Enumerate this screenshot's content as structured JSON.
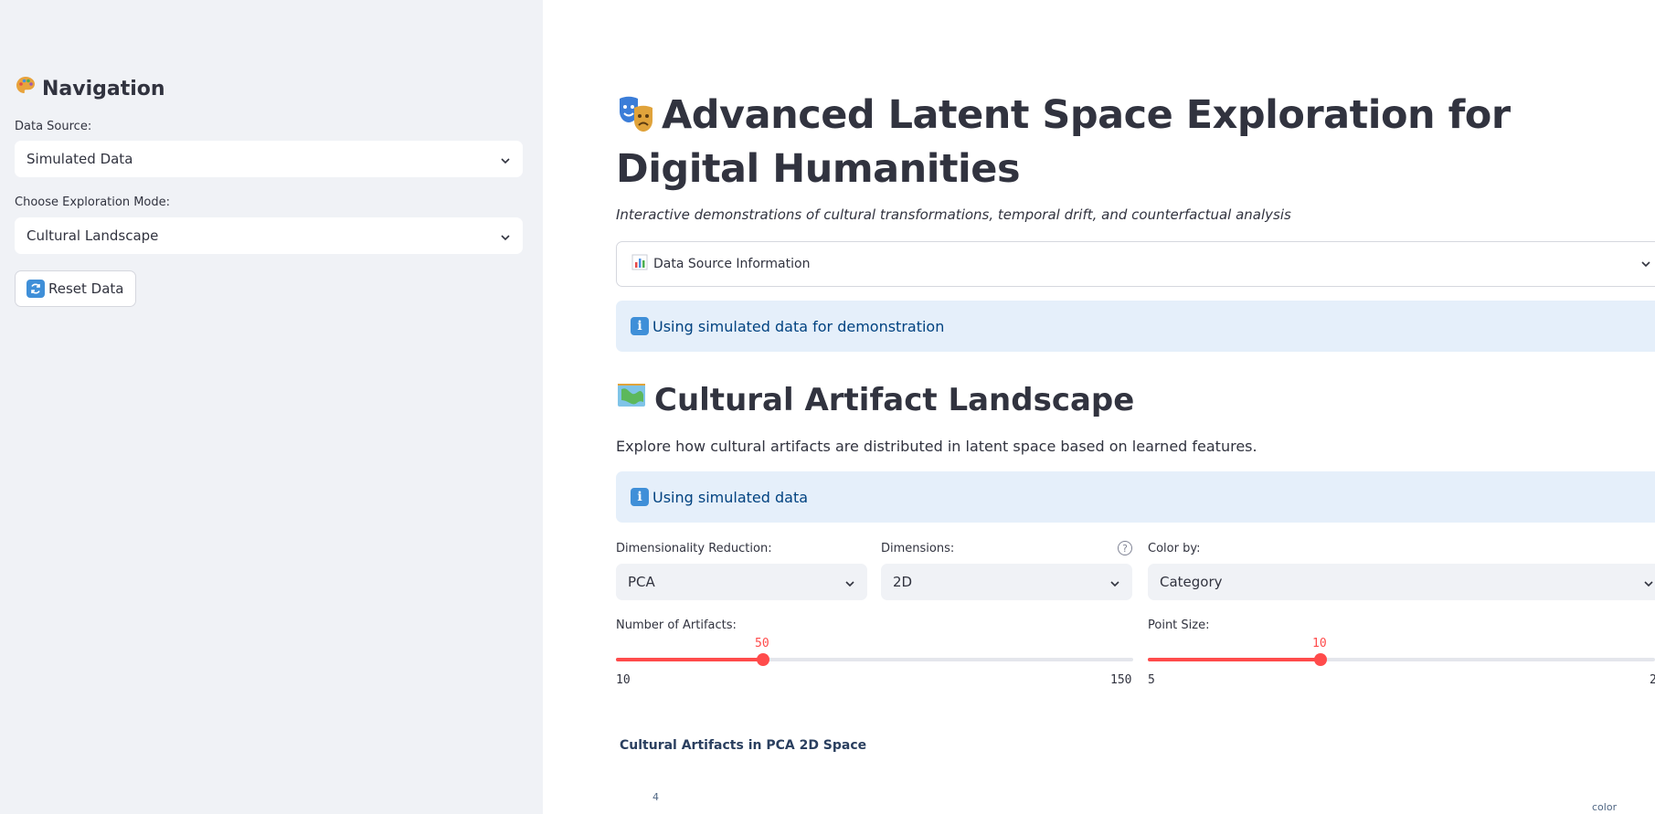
{
  "sidebar": {
    "title": "Navigation",
    "title_icon": "palette-icon",
    "data_source_label": "Data Source:",
    "data_source_value": "Simulated Data",
    "mode_label": "Choose Exploration Mode:",
    "mode_value": "Cultural Landscape",
    "reset_label": "Reset Data",
    "reset_icon": "refresh-icon"
  },
  "main": {
    "title_icon": "theater-masks-icon",
    "title": "Advanced Latent Space Exploration for Digital Humanities",
    "subtitle": "Interactive demonstrations of cultural transformations, temporal drift, and counterfactual analysis",
    "expander_label": "Data Source Information",
    "expander_icon": "bar-chart-icon",
    "info1": "Using simulated data for demonstration",
    "section_icon": "world-map-icon",
    "section_title": "Cultural Artifact Landscape",
    "section_desc": "Explore how cultural artifacts are distributed in latent space based on learned features.",
    "info2": "Using simulated data",
    "info_icon": "info-icon",
    "colors": {
      "accent": "#ff4b4b",
      "info_bg": "#e5effa",
      "info_text": "#004280"
    }
  },
  "controls": {
    "reduction_label": "Dimensionality Reduction:",
    "reduction_value": "PCA",
    "dimensions_label": "Dimensions:",
    "dimensions_value": "2D",
    "color_label": "Color by:",
    "color_value": "Category",
    "artifacts_label": "Number of Artifacts:",
    "artifacts_value": "50",
    "artifacts_min": "10",
    "artifacts_max": "150",
    "artifacts_fraction": 0.2857,
    "point_label": "Point Size:",
    "point_value": "10",
    "point_min": "5",
    "point_max": "2",
    "point_fraction": 0.333
  },
  "chart": {
    "title": "Cultural Artifacts in PCA 2D Space",
    "y_tick_top": "4",
    "legend_title": "color"
  }
}
